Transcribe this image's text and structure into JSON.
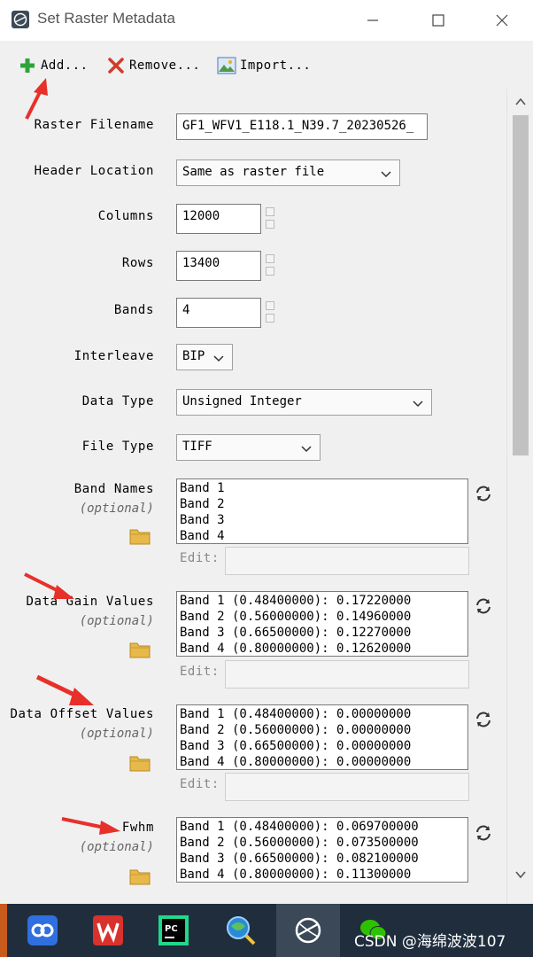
{
  "window": {
    "title": "Set Raster Metadata"
  },
  "toolbar": {
    "add_label": "Add...",
    "remove_label": "Remove...",
    "import_label": "Import..."
  },
  "form": {
    "raster_filename": {
      "label": "Raster Filename",
      "value": "GF1_WFV1_E118.1_N39.7_20230526_"
    },
    "header_location": {
      "label": "Header Location",
      "value": "Same as raster file"
    },
    "columns": {
      "label": "Columns",
      "value": "12000"
    },
    "rows": {
      "label": "Rows",
      "value": "13400"
    },
    "bands": {
      "label": "Bands",
      "value": "4"
    },
    "interleave": {
      "label": "Interleave",
      "value": "BIP"
    },
    "data_type": {
      "label": "Data Type",
      "value": "Unsigned Integer"
    },
    "file_type": {
      "label": "File Type",
      "value": "TIFF"
    },
    "optional_text": "(optional)",
    "edit_label": "Edit:",
    "band_names": {
      "label": "Band Names",
      "items": [
        "Band 1",
        "Band 2",
        "Band 3",
        "Band 4"
      ]
    },
    "gain": {
      "label": "Data Gain Values",
      "items": [
        "Band 1 (0.48400000): 0.17220000",
        "Band 2 (0.56000000): 0.14960000",
        "Band 3 (0.66500000): 0.12270000",
        "Band 4 (0.80000000): 0.12620000"
      ]
    },
    "offset": {
      "label": "Data Offset Values",
      "items": [
        "Band 1 (0.48400000): 0.00000000",
        "Band 2 (0.56000000): 0.00000000",
        "Band 3 (0.66500000): 0.00000000",
        "Band 4 (0.80000000): 0.00000000"
      ]
    },
    "fwhm": {
      "label": "Fwhm",
      "items": [
        "Band 1 (0.48400000): 0.069700000",
        "Band 2 (0.56000000): 0.073500000",
        "Band 3 (0.66500000): 0.082100000",
        "Band 4 (0.80000000): 0.11300000"
      ]
    }
  },
  "taskbar": {
    "apps": [
      "baidu-netdisk-icon",
      "wps-office-icon",
      "pycharm-icon",
      "search-globe-icon",
      "envi-icon",
      "wechat-icon"
    ],
    "watermark": "CSDN @海绵波波107"
  },
  "colors": {
    "annotation_arrow": "#e8302a",
    "taskbar": "#1f2d3d",
    "panel": "#f0f0f0"
  }
}
